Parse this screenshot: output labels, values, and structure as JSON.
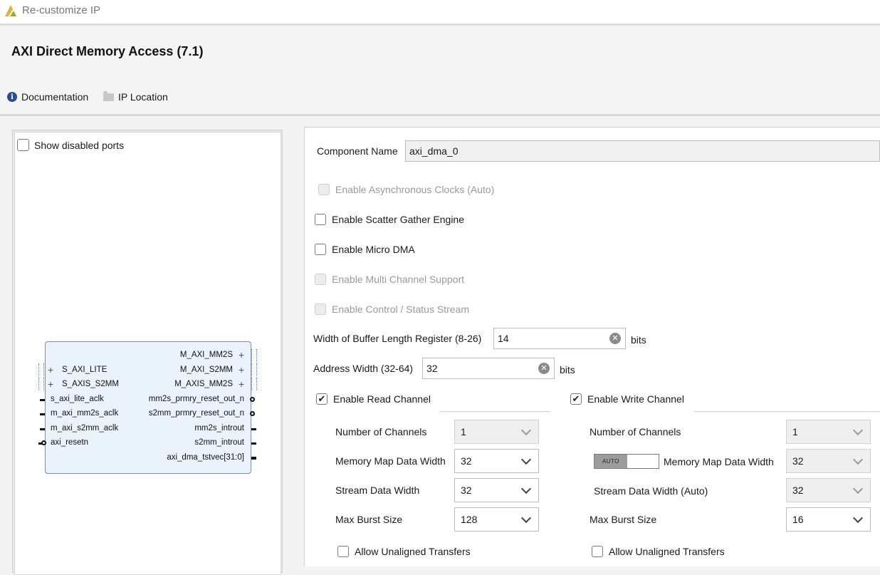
{
  "window": {
    "title": "Re-customize IP"
  },
  "header": {
    "ip_title": "AXI Direct Memory Access (7.1)",
    "documentation_label": "Documentation",
    "ip_location_label": "IP Location"
  },
  "left_panel": {
    "show_disabled_ports_label": "Show disabled ports",
    "block": {
      "left_ports": [
        "S_AXI_LITE",
        "S_AXIS_S2MM",
        "s_axi_lite_aclk",
        "m_axi_mm2s_aclk",
        "m_axi_s2mm_aclk",
        "axi_resetn"
      ],
      "right_ports": [
        "M_AXI_MM2S",
        "M_AXI_S2MM",
        "M_AXIS_MM2S",
        "mm2s_prmry_reset_out_n",
        "s2mm_prmry_reset_out_n",
        "mm2s_introut",
        "s2mm_introut",
        "axi_dma_tstvec[31:0]"
      ]
    }
  },
  "config": {
    "component_name_label": "Component Name",
    "component_name_value": "axi_dma_0",
    "async_clocks_label": "Enable Asynchronous Clocks (Auto)",
    "scatter_gather_label": "Enable Scatter Gather Engine",
    "micro_dma_label": "Enable Micro DMA",
    "multi_channel_label": "Enable Multi Channel Support",
    "control_status_label": "Enable Control / Status Stream",
    "buffer_length_label": "Width of Buffer Length Register (8-26)",
    "buffer_length_value": "14",
    "buffer_length_unit": "bits",
    "address_width_label": "Address Width (32-64)",
    "address_width_value": "32",
    "address_width_unit": "bits",
    "read_channel": {
      "enable_label": "Enable Read Channel",
      "num_channels_label": "Number of Channels",
      "num_channels_value": "1",
      "mm_data_width_label": "Memory Map Data Width",
      "mm_data_width_value": "32",
      "stream_data_width_label": "Stream Data Width",
      "stream_data_width_value": "32",
      "max_burst_label": "Max Burst Size",
      "max_burst_value": "128",
      "unaligned_label": "Allow Unaligned Transfers"
    },
    "write_channel": {
      "enable_label": "Enable Write Channel",
      "num_channels_label": "Number of Channels",
      "num_channels_value": "1",
      "auto_toggle_label": "AUTO",
      "mm_data_width_label": "Memory Map Data Width",
      "mm_data_width_value": "32",
      "stream_data_width_label": "Stream Data Width (Auto)",
      "stream_data_width_value": "32",
      "max_burst_label": "Max Burst Size",
      "max_burst_value": "16",
      "unaligned_label": "Allow Unaligned Transfers"
    }
  }
}
